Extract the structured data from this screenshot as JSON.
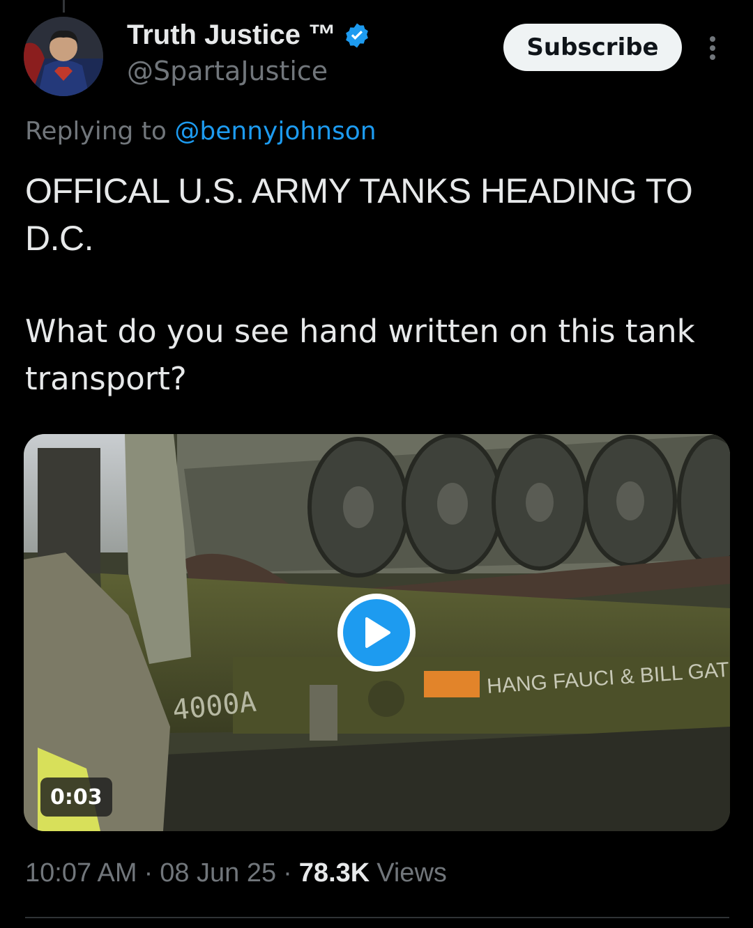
{
  "author": {
    "display_name": "Truth Justice ™",
    "handle": "@SpartaJustice",
    "verified": true,
    "avatar_icon": "avatar-image"
  },
  "actions": {
    "subscribe_label": "Subscribe",
    "more_icon": "more-vertical-icon"
  },
  "reply": {
    "prefix": "Replying to",
    "mention": "@bennyjohnson"
  },
  "post": {
    "headline": "OFFICAL U.S. ARMY TANKS HEADING TO\nD.C.",
    "body": "What do you see hand written on this tank\ntransport?"
  },
  "media": {
    "type": "video",
    "duration": "0:03",
    "play_icon": "play-icon",
    "visible_text": [
      "4000A",
      "HANG FAUCI & BILL GATE"
    ]
  },
  "meta": {
    "time": "10:07 AM",
    "separator": "·",
    "date": "08 Jun 25",
    "views_count": "78.3K",
    "views_label": "Views"
  },
  "colors": {
    "background": "#000000",
    "text_primary": "#e7e9ea",
    "text_secondary": "#71767b",
    "accent": "#1d9bf0",
    "button_bg": "#eff3f4"
  }
}
